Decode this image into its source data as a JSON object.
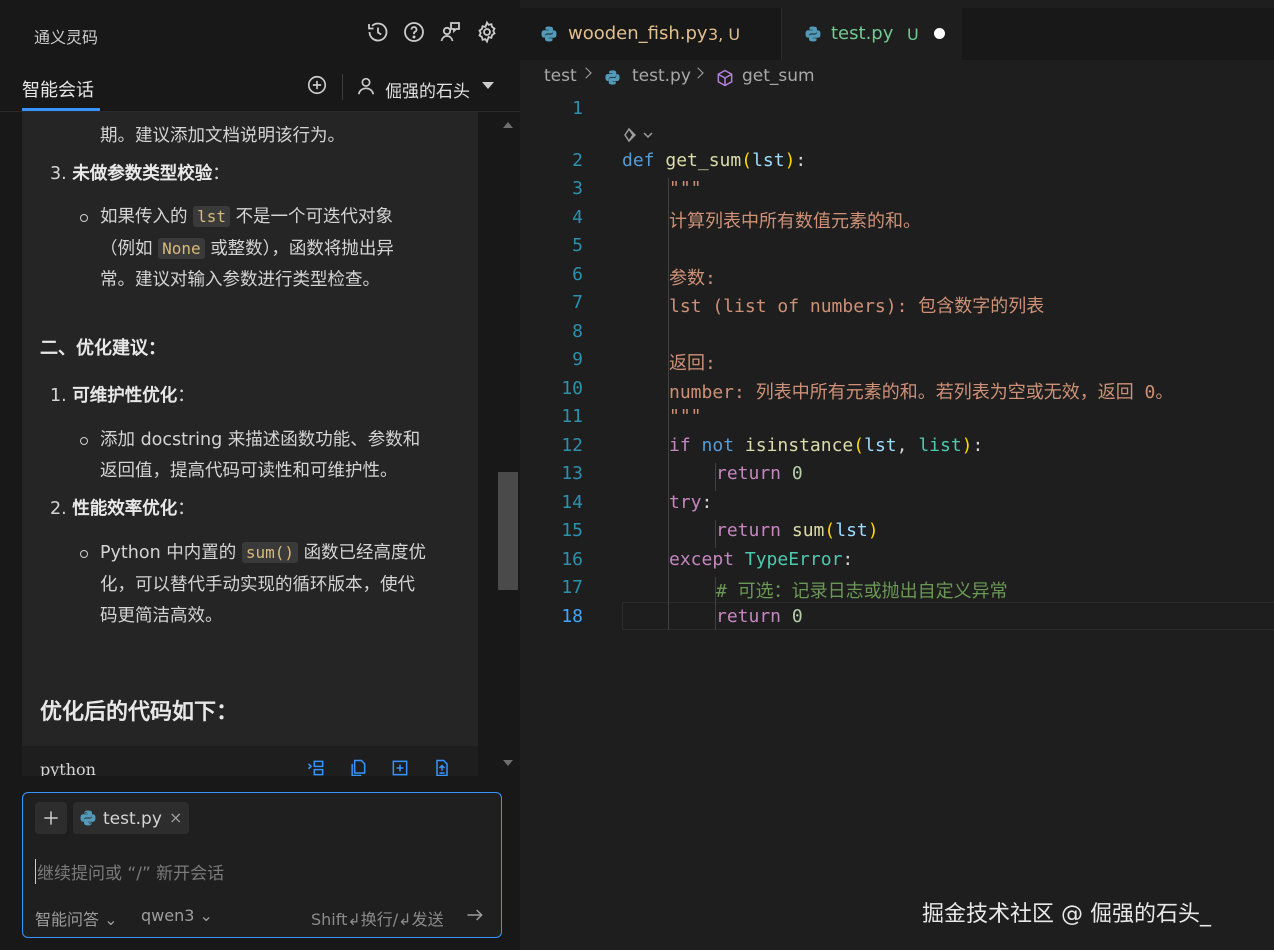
{
  "app": {
    "title": "通义灵码",
    "header_icons": [
      "history-icon",
      "help-icon",
      "feedback-icon",
      "settings-icon"
    ]
  },
  "chat_tabs": {
    "active_label": "智能会话",
    "user_name": "倔强的石头"
  },
  "chat": {
    "line_period": "期。建议添加文档说明该行为。",
    "item3_num": "3.",
    "item3_title": "未做参数类型校验",
    "item3_colon": "：",
    "item3_b1_a": "如果传入的",
    "item3_b1_code1": "lst",
    "item3_b1_b": "不是一个可迭代对象",
    "item3_b1_c": "（例如",
    "item3_b1_code2": "None",
    "item3_b1_d": "或整数），函数将抛出异",
    "item3_b1_e": "常。建议对输入参数进行类型检查。",
    "section2": "二、优化建议：",
    "opt1_num": "1.",
    "opt1_title": "可维护性优化",
    "opt1_colon": "：",
    "opt1_b1_a": "添加 docstring 来描述函数功能、参数和",
    "opt1_b1_b": "返回值，提高代码可读性和可维护性。",
    "opt2_num": "2.",
    "opt2_title": "性能效率优化",
    "opt2_colon": "：",
    "opt2_b1_a": "Python 中内置的",
    "opt2_b1_code": "sum()",
    "opt2_b1_b": "函数已经高度优",
    "opt2_b1_c": "化，可以替代手动实现的循环版本，使代",
    "opt2_b1_d": "码更简洁高效。",
    "optimized_title": "优化后的代码如下：",
    "code_lang": "python"
  },
  "input": {
    "file_chip": "test.py",
    "close": "×",
    "placeholder": "继续提问或 “/” 新开会话",
    "mode": "智能问答 ⌄",
    "model": "qwen3 ⌄",
    "hint": "Shift↲换行/↲发送"
  },
  "editor": {
    "tabs": [
      {
        "label": "wooden_fish.py",
        "status": "3, U"
      },
      {
        "label": "test.py",
        "status": "U"
      }
    ],
    "breadcrumb": [
      "test",
      "test.py",
      "get_sum"
    ],
    "line_numbers": [
      "1",
      "2",
      "3",
      "4",
      "5",
      "6",
      "7",
      "8",
      "9",
      "10",
      "11",
      "12",
      "13",
      "14",
      "15",
      "16",
      "17",
      "18"
    ],
    "lines": {
      "l2_def": "def",
      "l2_name": "get_sum",
      "l2_param": "lst",
      "l3": "\"\"\"",
      "l4": "计算列表中所有数值元素的和。",
      "l6": "参数:",
      "l7": "lst (list of numbers): 包含数字的列表",
      "l9": "返回:",
      "l10": "number: 列表中所有元素的和。若列表为空或无效，返回 0。",
      "l11": "\"\"\"",
      "l12_if": "if",
      "l12_not": "not",
      "l12_fn": "isinstance",
      "l12_arg1": "lst",
      "l12_arg2": "list",
      "l13_ret": "return",
      "l13_val": "0",
      "l14": "try",
      "l15_ret": "return",
      "l15_fn": "sum",
      "l15_arg": "lst",
      "l16_exc": "except",
      "l16_cls": "TypeError",
      "l17": "# 可选：记录日志或抛出自定义异常",
      "l18_ret": "return",
      "l18_val": "0"
    }
  },
  "watermark": "掘金技术社区 @ 倔强的石头_",
  "colors": {
    "accent": "#3794ff",
    "modified_tab": "#e2c08d",
    "untracked_tab": "#73c991"
  }
}
